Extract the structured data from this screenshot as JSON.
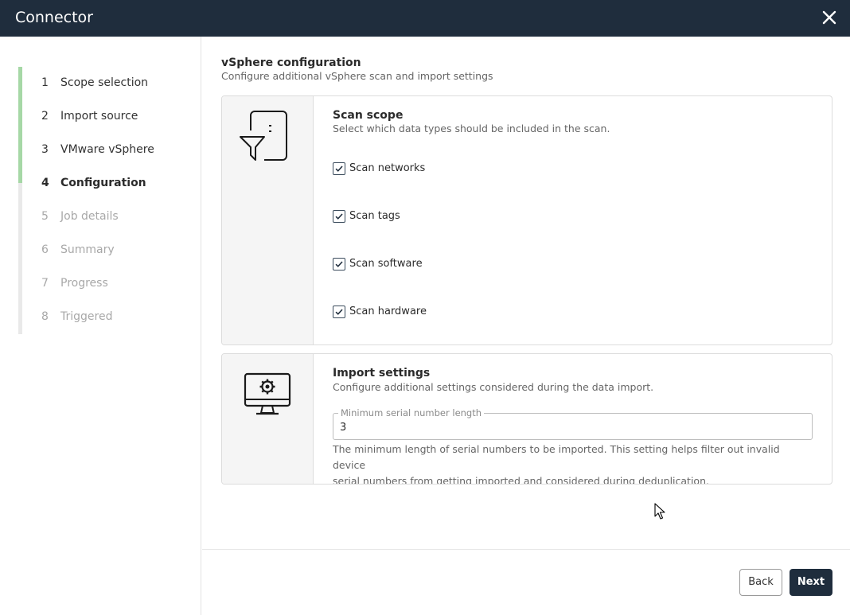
{
  "window": {
    "title": "Connector",
    "close_icon": "close-icon"
  },
  "steps": [
    {
      "num": "1",
      "label": "Scope selection",
      "state": "done"
    },
    {
      "num": "2",
      "label": "Import source",
      "state": "done"
    },
    {
      "num": "3",
      "label": "VMware vSphere",
      "state": "done"
    },
    {
      "num": "4",
      "label": "Configuration",
      "state": "active"
    },
    {
      "num": "5",
      "label": "Job details",
      "state": "pending"
    },
    {
      "num": "6",
      "label": "Summary",
      "state": "pending"
    },
    {
      "num": "7",
      "label": "Progress",
      "state": "pending"
    },
    {
      "num": "8",
      "label": "Triggered",
      "state": "pending"
    }
  ],
  "header": {
    "title": "vSphere configuration",
    "subtitle": "Configure additional vSphere scan and import settings"
  },
  "scan_scope": {
    "icon": "file-filter-icon",
    "title": "Scan scope",
    "subtitle": "Select which data types should be included in the scan.",
    "options": [
      {
        "label": "Scan networks",
        "checked": true
      },
      {
        "label": "Scan tags",
        "checked": true
      },
      {
        "label": "Scan software",
        "checked": true
      },
      {
        "label": "Scan hardware",
        "checked": true
      }
    ]
  },
  "import_settings": {
    "icon": "monitor-settings-icon",
    "title": "Import settings",
    "subtitle": "Configure additional settings considered during the data import.",
    "field_label": "Minimum serial number length",
    "field_value": "3",
    "help_line1": "The minimum length of serial numbers to be imported. This setting helps filter out invalid device",
    "help_line2": "serial numbers from getting imported and considered during deduplication."
  },
  "footer": {
    "back_label": "Back",
    "next_label": "Next"
  },
  "colors": {
    "titlebar": "#1f2d3d",
    "progress": "#a6d8a6",
    "primary_button": "#1f2d3d"
  }
}
